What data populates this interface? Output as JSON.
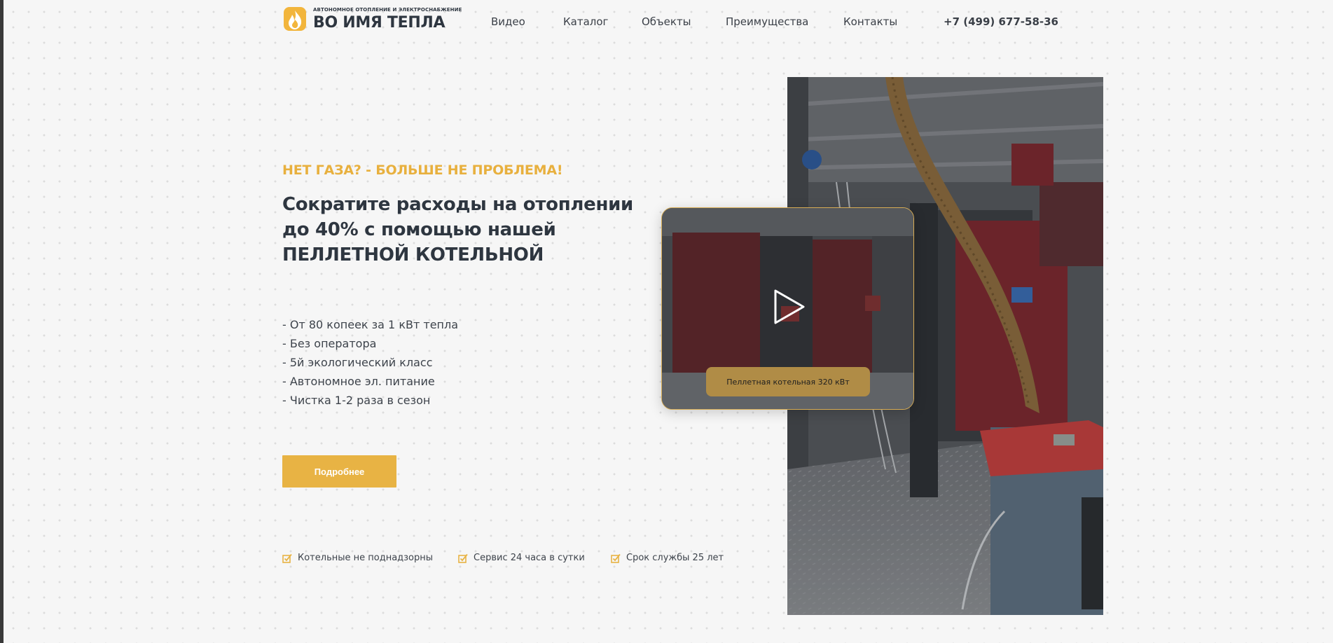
{
  "header": {
    "logo": {
      "tagline": "АВТОНОМНОЕ ОТОПЛЕНИЕ И ЭЛЕКТРОСНАБЖЕНИЕ",
      "name": "ВО ИМЯ ТЕПЛА",
      "icon": "flame-icon"
    },
    "nav": [
      {
        "label": "Видео"
      },
      {
        "label": "Каталог"
      },
      {
        "label": "Объекты"
      },
      {
        "label": "Преимущества"
      },
      {
        "label": "Контакты"
      }
    ],
    "phone": "+7 (499) 677-58-36"
  },
  "hero": {
    "eyebrow": "НЕТ ГАЗА? - БОЛЬШЕ НЕ ПРОБЛЕМА!",
    "headline": [
      "Сократите расходы на отоплении",
      "до 40% с помощью нашей",
      "ПЕЛЛЕТНОЙ КОТЕЛЬНОЙ"
    ],
    "features": [
      "- От 80 копеек за 1 кВт тепла",
      "- Без оператора",
      "- 5й экологический класс",
      "- Автономное эл. питание",
      "- Чистка 1-2 раза в сезон"
    ],
    "cta_label": "Подробнее",
    "badges": [
      {
        "text": "Котельные не поднадзорны",
        "icon": "checkbox-check-icon"
      },
      {
        "text": "Сервис 24 часа в сутки",
        "icon": "checkbox-check-icon"
      },
      {
        "text": "Срок службы 25 лет",
        "icon": "checkbox-check-icon"
      }
    ]
  },
  "video": {
    "label": "Пеллетная котельная 320 кВт",
    "icon": "play-icon"
  },
  "colors": {
    "accent": "#e8b344",
    "text": "#2e3640",
    "background": "#f6f6f6",
    "video_border": "#d8ad55"
  }
}
